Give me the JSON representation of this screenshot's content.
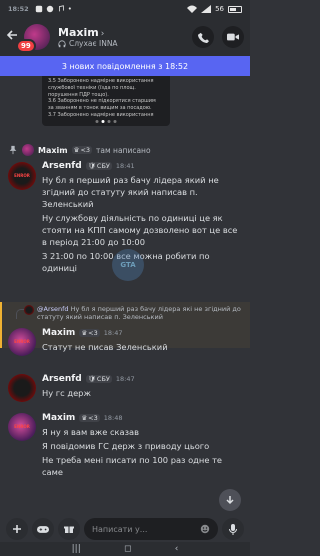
{
  "status_bar": {
    "time": "18:52",
    "battery": "56"
  },
  "header": {
    "badge": "99",
    "name": "Maxim",
    "status": "Слухає INNA"
  },
  "new_messages_bar": "3 нових повідомлення з 18:52",
  "previous_image": {
    "lines": [
      "3.5 Заборонено надмірне використання",
      "службової техніки (їзда по площ.",
      "порушення ПДР тощо).",
      "3.6 Заборонено не підкорятися старшим",
      "за званням в тонок вищим за посадою.",
      "3.7 Заборонено надмірне використання"
    ]
  },
  "pin_notice": {
    "name": "Maxim",
    "tag": "<3",
    "text": "там написано"
  },
  "messages": [
    {
      "author": "Arsenfd",
      "tag": "СБУ",
      "time": "18:41",
      "avatar_label": "ENROR",
      "paragraphs": [
        "Ну бл я перший раз бачу лідера який не згідний до статуту який написав п. Зеленський",
        "Ну службову діяльність по одиниці це як стояти на КПП самому дозволено вот це все в період 21:00 до 10:00",
        "З 21:00 по 10:00 все можна робити по одиниці"
      ]
    },
    {
      "author": "Maxim",
      "tag": "<3",
      "time": "18:47",
      "avatar_label": "ENROR",
      "reply_to": "@Arsenfd",
      "reply_text": "Ну бл я перший раз бачу лідера які не згідний до статуту який написав п. Зеленський",
      "paragraphs": [
        "Статут не писав Зеленський"
      ]
    },
    {
      "author": "Arsenfd",
      "tag": "СБУ",
      "time": "18:47",
      "paragraphs": [
        "Ну гс держ"
      ]
    },
    {
      "author": "Maxim",
      "tag": "<3",
      "time": "18:48",
      "avatar_label": "ENROR",
      "paragraphs": [
        "Я ну я вам вже сказав",
        "Я повідомив ГС держ з приводу цього",
        "Не треба мені писати по 100 раз одне те саме"
      ]
    }
  ],
  "watermark": "GTA",
  "composer": {
    "placeholder": "Написати у..."
  },
  "colors": {
    "accent": "#5865f2",
    "background": "#313338",
    "header": "#2b2d31"
  }
}
